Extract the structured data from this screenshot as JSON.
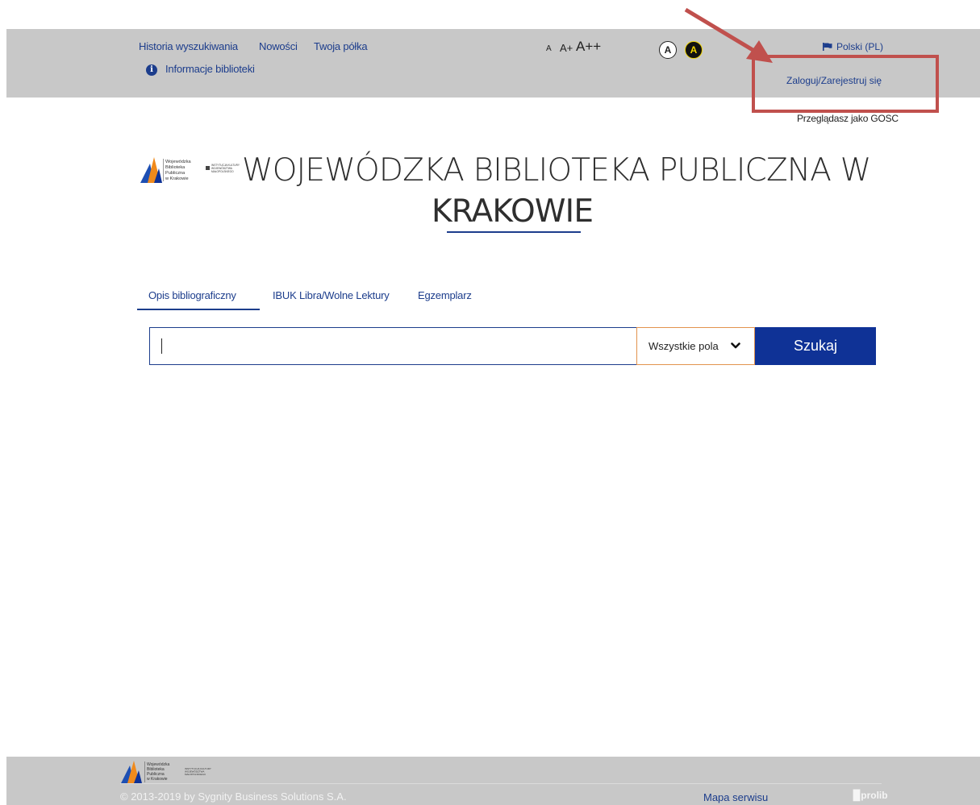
{
  "header": {
    "nav": [
      "Historia wyszukiwania",
      "Nowości",
      "Twoja półka"
    ],
    "info_link": "Informacje biblioteki",
    "font_sizes": [
      "A",
      "A+",
      "A++"
    ],
    "contrast": [
      "A",
      "A"
    ],
    "language": "Polski (PL)",
    "login": "Zaloguj/Zarejestruj się",
    "guest_status": "Przeglądasz jako GOSC"
  },
  "main": {
    "title_line1": "WOJEWÓDZKA BIBLIOTEKA PUBLICZNA W",
    "title_line2": "KRAKOWIE",
    "logo_text": [
      "Wojewódzka",
      "Biblioteka",
      "Publiczna",
      "w Krakowie"
    ],
    "logo_sub": [
      "INSTYTUCJA KULTURY",
      "WOJEWÓDZTWA",
      "MAŁOPOLSKIEGO"
    ],
    "tabs": [
      "Opis bibliograficzny",
      "IBUK Libra/Wolne Lektury",
      "Egzemplarz"
    ],
    "search": {
      "value": "",
      "field_selected": "Wszystkie pola",
      "button": "Szukaj"
    }
  },
  "footer": {
    "copyright": "© 2013-2019 by Sygnity Business Solutions S.A.",
    "sitemap": "Mapa serwisu",
    "brand": "prolib"
  },
  "colors": {
    "primary": "#0f3296",
    "link": "#1c3d8c",
    "bar_gray": "#c8c8c8",
    "annotation": "#c0504d"
  }
}
